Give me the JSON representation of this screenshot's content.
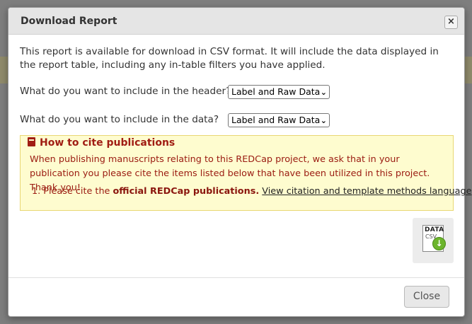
{
  "dialog": {
    "title": "Download Report",
    "close_icon": "×",
    "intro": "This report is available for download in CSV format. It will include the data displayed in the report table, including any in-table filters you have applied.",
    "header_question": "What do you want to include in the header?",
    "header_select_value": "Label and Raw Data",
    "data_question": "What do you want to include in the data?",
    "data_select_value": "Label and Raw Data",
    "select_icon": "chevron-down-icon"
  },
  "citation": {
    "title": "How to cite publications",
    "body": "When publishing manuscripts relating to this REDCap project, we ask that in your publication you please cite the items listed below that have been utilized in this project. Thank you!",
    "item_prefix": "1. Please cite the ",
    "item_bold": "official REDCap publications.",
    "item_link": "View citation and template methods language",
    "title_color": "#a01d13",
    "background_color": "#fefccf"
  },
  "download": {
    "icon_line1": "DATA",
    "icon_line2": "CSV",
    "arrow": "↓",
    "arrow_color": "#6cb52c"
  },
  "footer": {
    "close_label": "Close"
  }
}
